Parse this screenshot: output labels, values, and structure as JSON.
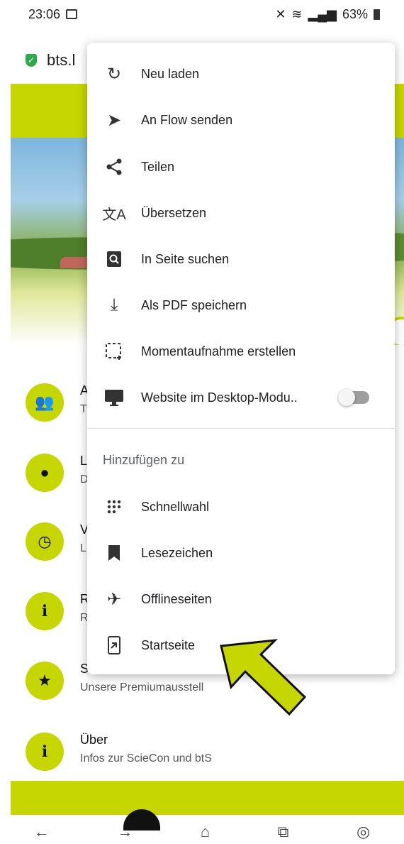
{
  "status": {
    "time": "23:06",
    "battery": "63%"
  },
  "url_bar": {
    "text": "bts.l"
  },
  "background_list": [
    {
      "icon": "group-icon",
      "title": "A",
      "subtitle": "T"
    },
    {
      "icon": "location-pin-icon",
      "title": "L",
      "subtitle": "D"
    },
    {
      "icon": "clock-icon",
      "title": "V",
      "subtitle": "L"
    },
    {
      "icon": "info-icon",
      "title": "R",
      "subtitle": "R"
    },
    {
      "icon": "star-icon",
      "title": "S",
      "subtitle": "Unsere Premiumausstell"
    },
    {
      "icon": "info-icon",
      "title": "Über",
      "subtitle": "Infos zur ScieCon und btS"
    }
  ],
  "menu": {
    "items": [
      {
        "icon": "reload-icon",
        "label": "Neu laden"
      },
      {
        "icon": "send-icon",
        "label": "An Flow senden"
      },
      {
        "icon": "share-icon",
        "label": "Teilen"
      },
      {
        "icon": "translate-icon",
        "label": "Übersetzen"
      },
      {
        "icon": "find-in-page-icon",
        "label": "In Seite suchen"
      },
      {
        "icon": "download-icon",
        "label": "Als PDF speichern"
      },
      {
        "icon": "screenshot-icon",
        "label": "Momentaufnahme erstellen"
      },
      {
        "icon": "desktop-icon",
        "label": "Website im Desktop-Modu.."
      }
    ],
    "section_header": "Hinzufügen zu",
    "add_items": [
      {
        "icon": "speed-dial-icon",
        "label": "Schnellwahl"
      },
      {
        "icon": "bookmark-icon",
        "label": "Lesezeichen"
      },
      {
        "icon": "airplane-icon",
        "label": "Offlineseiten"
      },
      {
        "icon": "add-to-home-icon",
        "label": "Startseite"
      }
    ],
    "desktop_mode_enabled": false
  },
  "colors": {
    "brand": "#c6d600",
    "arrow": "#c6d600"
  }
}
